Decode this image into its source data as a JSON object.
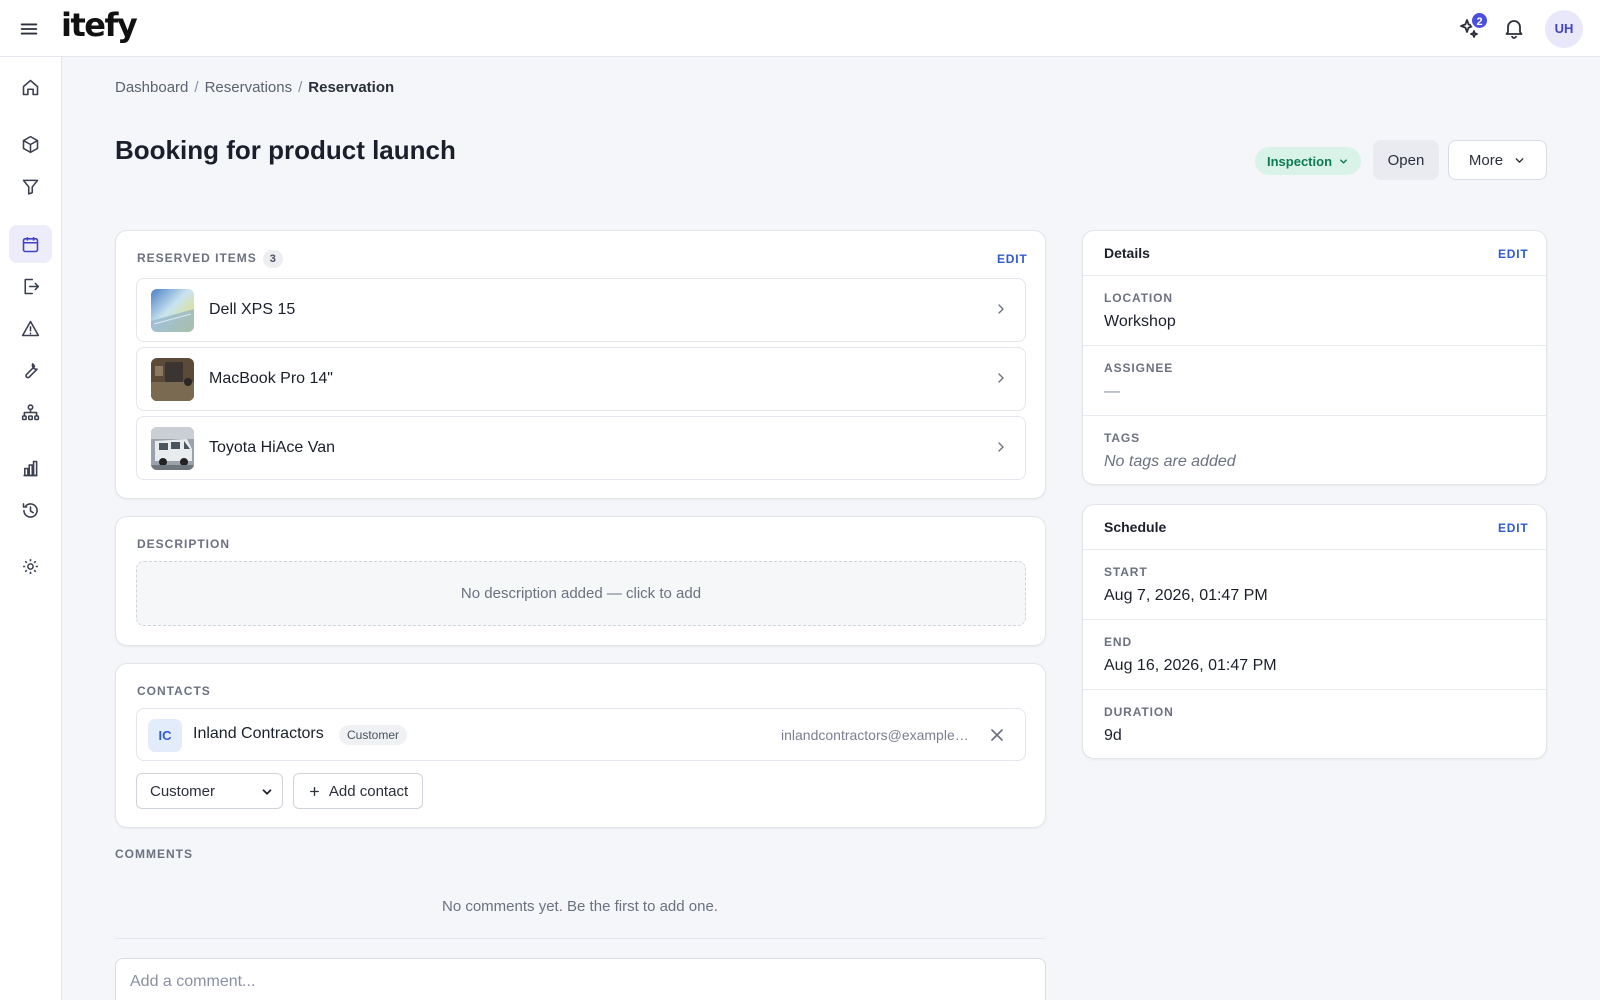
{
  "app": {
    "logo": "itefy",
    "notifications_badge": "2",
    "user_initials": "UH"
  },
  "breadcrumb": {
    "items": [
      "Dashboard",
      "Reservations"
    ],
    "current": "Reservation",
    "separator": "/"
  },
  "page": {
    "title": "Booking for product launch"
  },
  "actions": {
    "status": "Inspection",
    "open": "Open",
    "more": "More"
  },
  "reserved_items": {
    "label": "Reserved Items",
    "count": "3",
    "edit": "EDIT",
    "items": [
      {
        "name": "Dell XPS 15"
      },
      {
        "name": "MacBook Pro 14\""
      },
      {
        "name": "Toyota HiAce Van"
      }
    ]
  },
  "description": {
    "label": "Description",
    "placeholder": "No description added — click to add"
  },
  "contacts": {
    "label": "Contacts",
    "items": [
      {
        "initials": "IC",
        "name": "Inland Contractors",
        "role": "Customer",
        "email": "inlandcontractors@example.com"
      }
    ],
    "role_select": "Customer",
    "add_label": "Add contact"
  },
  "comments": {
    "label": "Comments",
    "empty": "No comments yet. Be the first to add one.",
    "placeholder": "Add a comment..."
  },
  "details": {
    "title": "Details",
    "edit": "EDIT",
    "location_label": "Location",
    "location": "Workshop",
    "assignee_label": "Assignee",
    "assignee": "—",
    "tags_label": "Tags",
    "tags": "No tags are added"
  },
  "schedule": {
    "title": "Schedule",
    "edit": "EDIT",
    "start_label": "Start",
    "start": "Aug 7, 2026, 01:47 PM",
    "end_label": "End",
    "end": "Aug 16, 2026, 01:47 PM",
    "duration_label": "Duration",
    "duration": "9d"
  },
  "colors": {
    "accent": "#4b4fe0",
    "status_bg": "#d9f3e8",
    "status_text": "#0d7a55",
    "link": "#2f5bd0"
  },
  "icons": {
    "sidebar": [
      "home-icon",
      "box-icon",
      "filter-icon",
      "calendar-icon",
      "checkout-icon",
      "warning-icon",
      "wrench-icon",
      "org-chart-icon",
      "bar-chart-icon",
      "history-icon",
      "settings-icon"
    ],
    "topbar": [
      "menu-icon",
      "sparkle-icon",
      "bell-icon"
    ]
  }
}
